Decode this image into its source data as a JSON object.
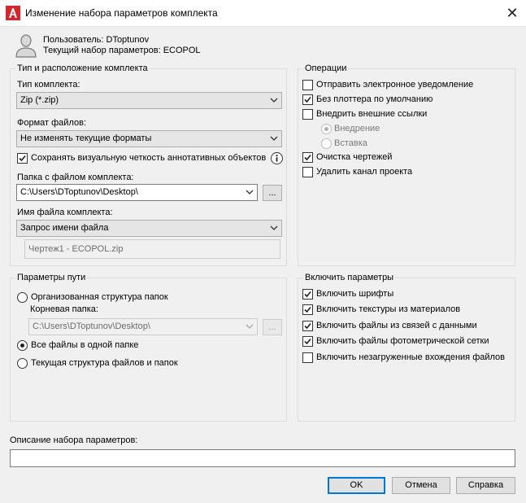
{
  "window": {
    "title": "Изменение набора параметров комплекта",
    "close_glyph": "✕"
  },
  "user": {
    "user_line": "Пользователь: DToptunov",
    "set_line": "Текущий набор параметров: ECOPOL"
  },
  "package": {
    "legend": "Тип и расположение комплекта",
    "type_label": "Тип комплекта:",
    "type_value": "Zip (*.zip)",
    "format_label": "Формат файлов:",
    "format_value": "Не изменять текущие форматы",
    "keep_fidelity_label": "Сохранять визуальную четкость аннотативных объектов",
    "keep_fidelity_checked": true,
    "folder_label": "Папка с файлом комплекта:",
    "folder_value": "C:\\Users\\DToptunov\\Desktop\\",
    "browse_label": "...",
    "filename_label": "Имя файла комплекта:",
    "filename_value": "Запрос имени файла",
    "filename_preview": "Чертеж1 - ECOPOL.zip"
  },
  "operations": {
    "legend": "Операции",
    "items": [
      {
        "label": "Отправить электронное уведомление",
        "checked": false
      },
      {
        "label": "Без плоттера по умолчанию",
        "checked": true
      },
      {
        "label": "Внедрить внешние ссылки",
        "checked": false
      }
    ],
    "bind_options": [
      {
        "label": "Внедрение",
        "selected": true
      },
      {
        "label": "Вставка",
        "selected": false
      }
    ],
    "items2": [
      {
        "label": "Очистка чертежей",
        "checked": true
      },
      {
        "label": "Удалить канал проекта",
        "checked": false
      }
    ]
  },
  "paths": {
    "legend": "Параметры пути",
    "options": [
      {
        "label": "Организованная структура папок",
        "selected": false
      },
      {
        "label": "Все файлы в одной папке",
        "selected": true
      },
      {
        "label": "Текущая структура файлов и папок",
        "selected": false
      }
    ],
    "root_label": "Корневая папка:",
    "root_value": "C:\\Users\\DToptunov\\Desktop\\",
    "root_browse": "..."
  },
  "include": {
    "legend": "Включить параметры",
    "items": [
      {
        "label": "Включить шрифты",
        "checked": true
      },
      {
        "label": "Включить текстуры из материалов",
        "checked": true
      },
      {
        "label": "Включить файлы из связей с данными",
        "checked": true
      },
      {
        "label": "Включить файлы фотометрической сетки",
        "checked": true
      },
      {
        "label": "Включить незагруженные вхождения файлов",
        "checked": false
      }
    ]
  },
  "description": {
    "label": "Описание набора параметров:",
    "value": ""
  },
  "buttons": {
    "ok": "OK",
    "cancel": "Отмена",
    "help": "Справка"
  },
  "colors": {
    "accent": "#0078d7",
    "logo_red": "#d7262b",
    "dialog_bg": "#f0f0f0"
  },
  "icons": {
    "logo": "autocad-logo-icon",
    "user": "user-icon",
    "info": "info-icon",
    "dropdown": "chevron-down-icon",
    "close": "close-icon"
  }
}
